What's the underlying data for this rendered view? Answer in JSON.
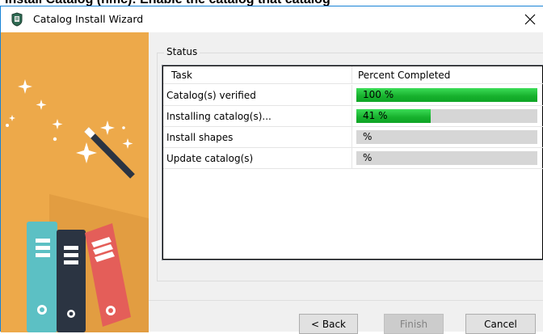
{
  "window": {
    "title": "Catalog Install Wizard",
    "accent_color": "#1883d7",
    "close_icon": "close-icon",
    "app_icon": "catalog-install-icon"
  },
  "partial_top_text": "Install Catalog (hmc): Enable the catalog that catalog",
  "sidebar_art": {
    "description_icons": [
      "magic-wand-icon",
      "sparkle-icon",
      "binder-icon"
    ],
    "background_color": "#eda94a"
  },
  "status": {
    "group_label": "Status",
    "columns": [
      "Task",
      "Percent Completed"
    ],
    "tasks": [
      {
        "name": "Catalog(s) verified",
        "percent": 100,
        "percent_label": "100 %"
      },
      {
        "name": "Installing catalog(s)...",
        "percent": 41,
        "percent_label": "41 %"
      },
      {
        "name": "Install shapes",
        "percent": 0,
        "percent_label": "%"
      },
      {
        "name": "Update catalog(s)",
        "percent": 0,
        "percent_label": "%"
      }
    ]
  },
  "buttons": {
    "back": "< Back",
    "finish": "Finish",
    "cancel": "Cancel",
    "finish_enabled": false
  }
}
